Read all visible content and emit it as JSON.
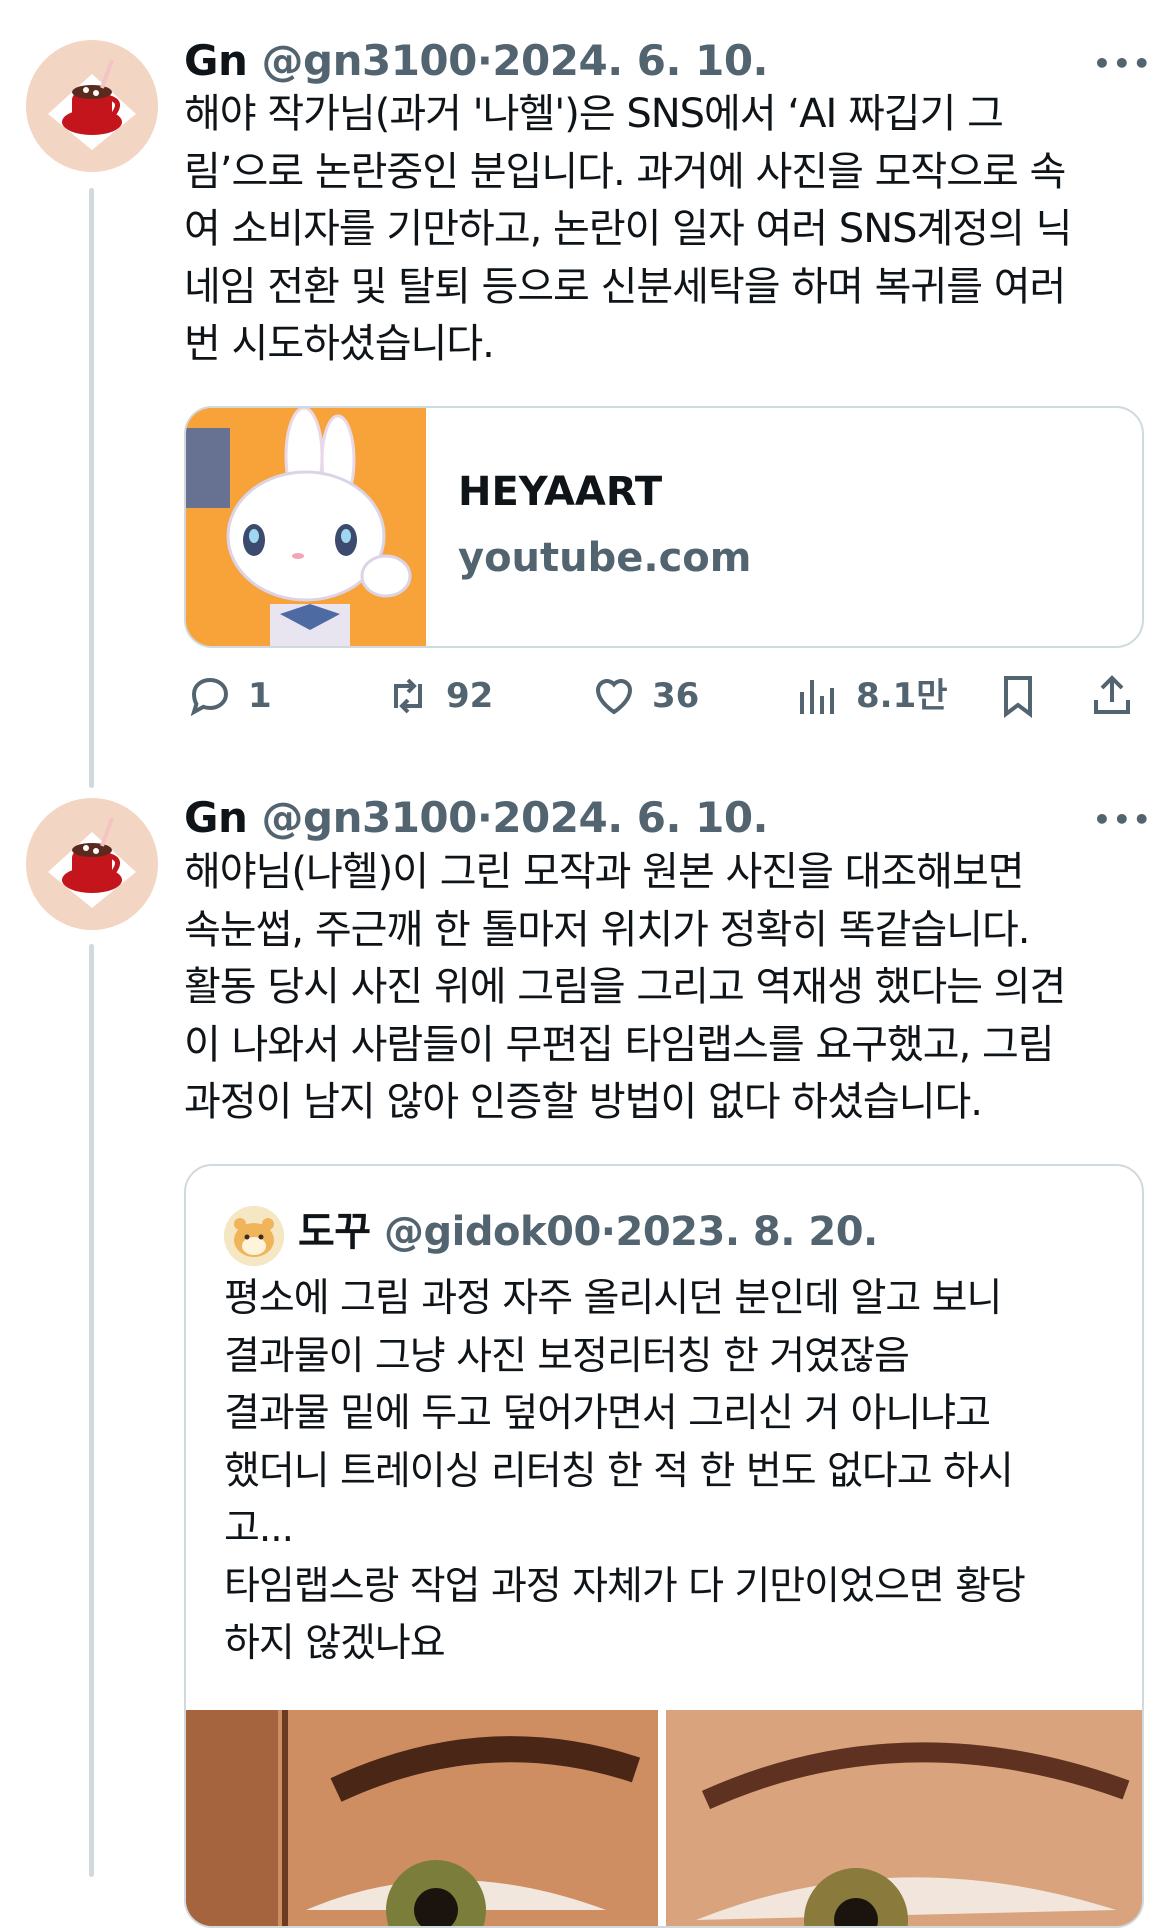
{
  "tweets": [
    {
      "name": "Gn",
      "handle": "@gn3100",
      "separator": "·",
      "date": "2024. 6. 10.",
      "more_label": "•••",
      "text_lines": [
        "해야 작가님(과거 '나헬')은 SNS에서 ‘AI 짜깁기 그",
        "림’으로 논란중인 분입니다. 과거에 사진을 모작으로 속",
        "여 소비자를 기만하고, 논란이 일자 여러 SNS계정의 닉",
        "네임 전환 및 탈퇴 등으로 신분세탁을 하며 복귀를 여러",
        "번 시도하셨습니다."
      ],
      "link_card": {
        "title": "HEYAART",
        "domain": "youtube.com"
      },
      "actions": {
        "replies": "1",
        "retweets": "92",
        "likes": "36",
        "views": "8.1만"
      }
    },
    {
      "name": "Gn",
      "handle": "@gn3100",
      "separator": "·",
      "date": "2024. 6. 10.",
      "more_label": "•••",
      "text_lines": [
        "해야님(나헬)이 그린 모작과 원본 사진을 대조해보면",
        "속눈썹, 주근깨 한 톨마저 위치가 정확히 똑같습니다.",
        "활동 당시 사진 위에 그림을 그리고 역재생 했다는 의견",
        "이 나와서 사람들이 무편집 타임랩스를 요구했고, 그림",
        "과정이 남지 않아 인증할 방법이 없다 하셨습니다."
      ],
      "quote": {
        "name": "도꾸",
        "handle": "@gidok00",
        "separator": "·",
        "date": "2023. 8. 20.",
        "text_lines": [
          "평소에 그림 과정 자주 올리시던 분인데 알고 보니",
          "결과물이 그냥 사진 보정리터칭 한 거였잖음",
          "결과물 밑에 두고 덮어가면서 그리신 거 아니냐고",
          "했더니 트레이싱 리터칭 한 적 한 번도 없다고 하시",
          "고...",
          "타임랩스랑 작업 과정 자체가 다 기만이었으면 황당",
          "하지 않겠나요"
        ]
      }
    }
  ],
  "icons": {
    "avatar": "cake-avatar",
    "card_image": "bunny-character",
    "reply": "reply-icon",
    "retweet": "retweet-icon",
    "like": "heart-icon",
    "views": "views-icon",
    "bookmark": "bookmark-icon",
    "share": "share-icon"
  },
  "colors": {
    "text": "#0f1419",
    "secondary": "#536471",
    "border": "#cfd9de",
    "card_bg": "#f7a33a"
  }
}
